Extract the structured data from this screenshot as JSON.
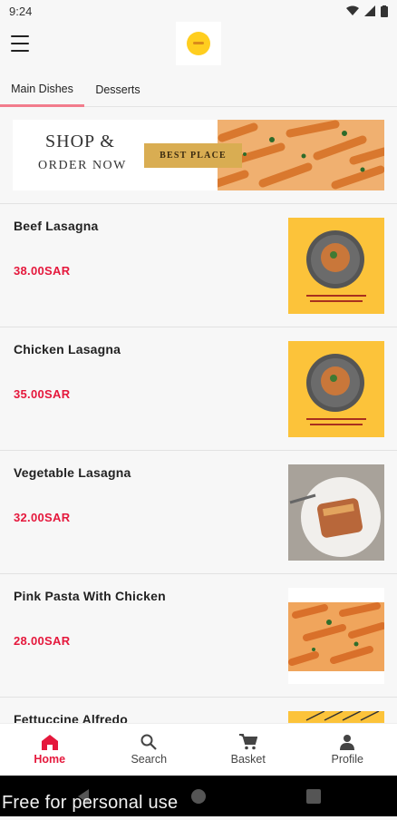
{
  "status_bar": {
    "time": "9:24"
  },
  "tabs": [
    {
      "label": "Main Dishes",
      "active": true
    },
    {
      "label": "Desserts",
      "active": false
    }
  ],
  "banner": {
    "title": "SHOP &",
    "subtitle": "ORDER NOW",
    "badge": "BEST PLACE"
  },
  "items": [
    {
      "name": "Beef Lasagna",
      "price": "38.00SAR",
      "image": "lasagna-bowl-on-yellow"
    },
    {
      "name": "Chicken Lasagna",
      "price": "35.00SAR",
      "image": "lasagna-bowl-on-yellow"
    },
    {
      "name": "Vegetable Lasagna",
      "price": "32.00SAR",
      "image": "lasagna-plate-photo"
    },
    {
      "name": "Pink Pasta With Chicken",
      "price": "28.00SAR",
      "image": "penne-pasta-photo"
    },
    {
      "name": "Fettuccine Alfredo",
      "price": "",
      "image": "yellow-pattern"
    }
  ],
  "bottom_nav": [
    {
      "label": "Home",
      "icon": "home-icon",
      "active": true
    },
    {
      "label": "Search",
      "icon": "search-icon",
      "active": false
    },
    {
      "label": "Basket",
      "icon": "cart-icon",
      "active": false
    },
    {
      "label": "Profile",
      "icon": "person-icon",
      "active": false
    }
  ],
  "watermark": "Free for personal use",
  "colors": {
    "accent": "#e5183c",
    "tab_indicator": "#f27c8c",
    "banner_badge": "#d9ad52"
  }
}
